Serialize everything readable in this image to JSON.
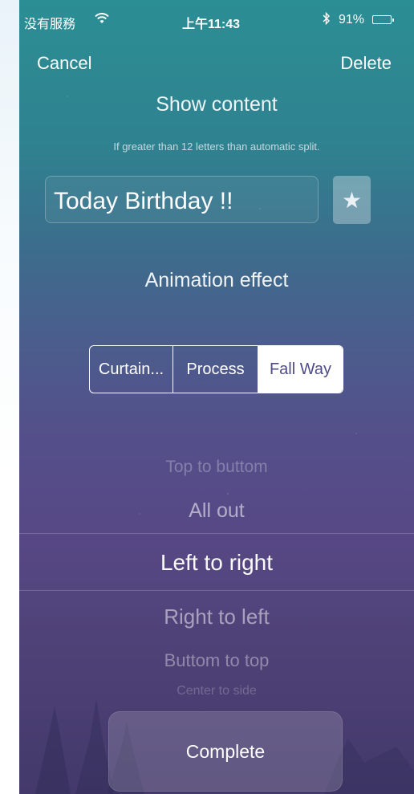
{
  "status_bar": {
    "carrier": "没有服務",
    "wifi_icon": "wifi-icon",
    "time": "上午11:43",
    "bluetooth_icon": "bluetooth-icon",
    "battery_percent": "91%",
    "battery_level": 0.91
  },
  "nav": {
    "cancel": "Cancel",
    "delete": "Delete"
  },
  "content_section": {
    "title": "Show content",
    "hint": "If greater than 12 letters than automatic split.",
    "text_value": "Today Birthday !!",
    "star_icon": "star-icon"
  },
  "animation_section": {
    "title": "Animation effect",
    "segments": [
      {
        "label": "Curtain...",
        "selected": false
      },
      {
        "label": "Process",
        "selected": false
      },
      {
        "label": "Fall Way",
        "selected": true
      }
    ]
  },
  "picker": {
    "items": [
      "Top to buttom",
      "All out",
      "Left to right",
      "Right to left",
      "Buttom to top",
      "Center to side"
    ],
    "selected": "Left to right"
  },
  "footer": {
    "complete": "Complete"
  },
  "colors": {
    "background_top": "#2b8e94",
    "background_bottom": "#43396a",
    "selected_segment_text": "#4e4d86"
  }
}
